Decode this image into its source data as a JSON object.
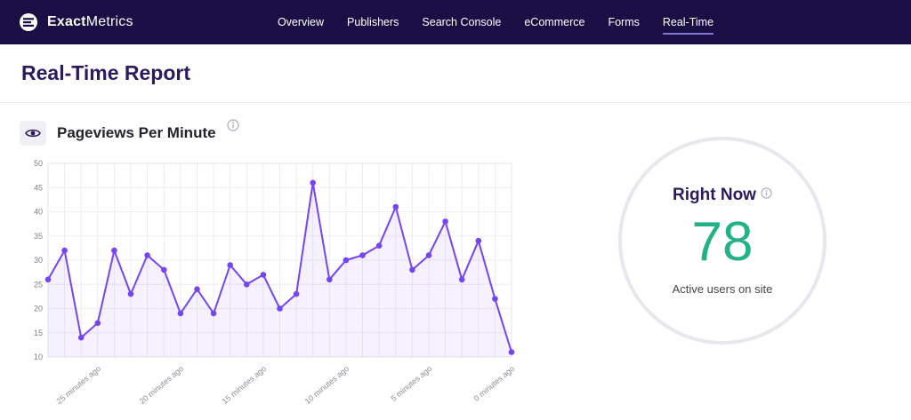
{
  "nav": {
    "brand_bold": "Exact",
    "brand_regular": "Metrics",
    "items": [
      {
        "label": "Overview",
        "active": false
      },
      {
        "label": "Publishers",
        "active": false
      },
      {
        "label": "Search Console",
        "active": false
      },
      {
        "label": "eCommerce",
        "active": false
      },
      {
        "label": "Forms",
        "active": false
      },
      {
        "label": "Real-Time",
        "active": true
      }
    ]
  },
  "header": {
    "title": "Real-Time Report"
  },
  "chart_panel": {
    "title": "Pageviews Per Minute"
  },
  "right_now": {
    "title": "Right Now",
    "value": "78",
    "subtitle": "Active users on site"
  },
  "colors": {
    "navbar_bg": "#1a0f45",
    "accent_purple": "#7545f5",
    "green": "#22b286",
    "title_purple": "#2c1a5e"
  },
  "chart_data": {
    "type": "line",
    "title": "Pageviews Per Minute",
    "x_unit": "minutes ago",
    "values": [
      26,
      32,
      14,
      17,
      32,
      23,
      31,
      28,
      19,
      24,
      19,
      29,
      25,
      27,
      20,
      23,
      46,
      26,
      30,
      31,
      33,
      41,
      28,
      31,
      38,
      26,
      34,
      22,
      11
    ],
    "ylim": [
      10,
      50
    ],
    "ytick": 5,
    "grid": true,
    "legend": false,
    "x_labels": [
      {
        "index": 3,
        "text": "25 minutes ago"
      },
      {
        "index": 8,
        "text": "20 minutes ago"
      },
      {
        "index": 13,
        "text": "15 minutes ago"
      },
      {
        "index": 18,
        "text": "10 minutes ago"
      },
      {
        "index": 23,
        "text": "5 minutes ago"
      },
      {
        "index": 28,
        "text": "0 minutes ago"
      }
    ]
  }
}
